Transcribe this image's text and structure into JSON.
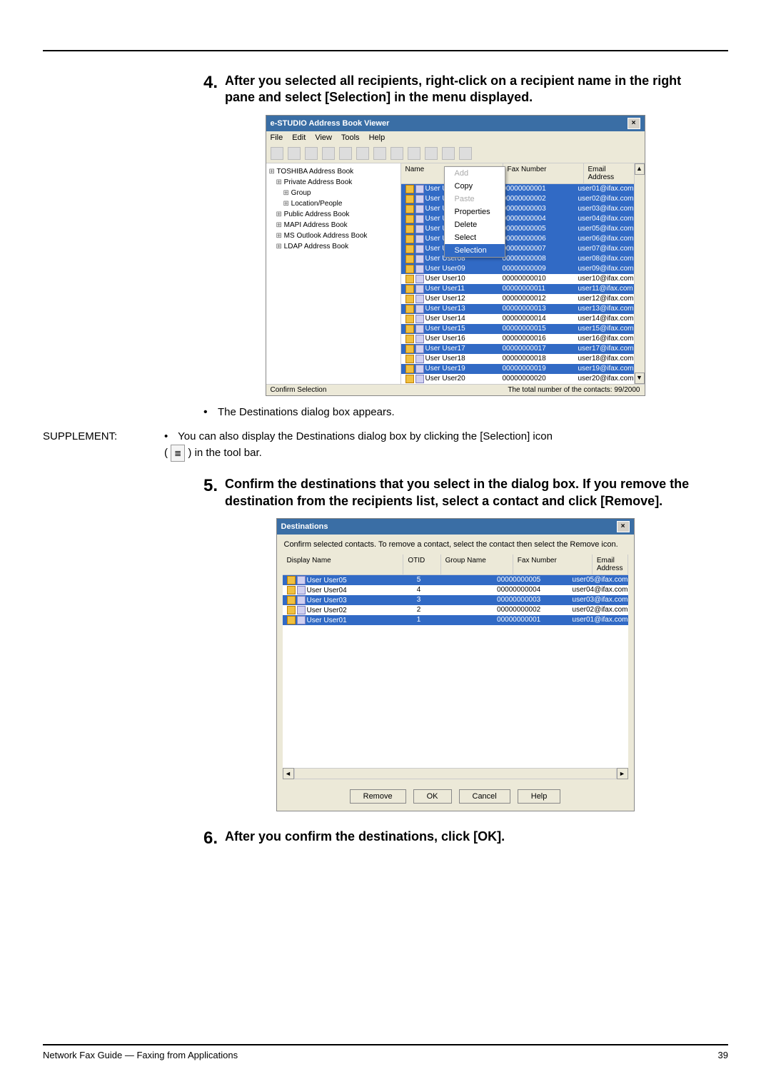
{
  "steps": {
    "s4": {
      "num": "4.",
      "text": "After you selected all recipients,  right-click on a recipient name in the right pane and select [Selection] in the menu displayed."
    },
    "s5": {
      "num": "5.",
      "text": "Confirm the destinations that you select in the dialog box.  If you remove the destination from the recipients list, select a contact and click [Remove]."
    },
    "s6": {
      "num": "6.",
      "text": "After you confirm the destinations, click [OK]."
    }
  },
  "bullet1": "The Destinations dialog box appears.",
  "supplement": {
    "label": "SUPPLEMENT:",
    "text1": "You can also display the Destinations dialog box by clicking the [Selection] icon",
    "text2": ") in the tool bar.",
    "iconglyph": "≣"
  },
  "win1": {
    "title": "e-STUDIO Address Book Viewer",
    "menus": [
      "File",
      "Edit",
      "View",
      "Tools",
      "Help"
    ],
    "tree": [
      "TOSHIBA Address Book",
      "Private Address Book",
      "Group",
      "Location/People",
      "Public Address Book",
      "MAPI Address Book",
      "MS Outlook Address Book",
      "LDAP Address Book"
    ],
    "cols": {
      "name": "Name",
      "fax": "Fax Number",
      "email": "Email Address"
    },
    "ctx": [
      "Add",
      "Copy",
      "Paste",
      "Properties",
      "Delete",
      "Select",
      "Selection"
    ],
    "rows": [
      {
        "n": "User User01",
        "f": "00000000001",
        "e": "user01@ifax.com",
        "sel": true
      },
      {
        "n": "User User02",
        "f": "00000000002",
        "e": "user02@ifax.com",
        "sel": true
      },
      {
        "n": "User User03",
        "f": "00000000003",
        "e": "user03@ifax.com",
        "sel": true
      },
      {
        "n": "User User04",
        "f": "00000000004",
        "e": "user04@ifax.com",
        "sel": true
      },
      {
        "n": "User User05",
        "f": "00000000005",
        "e": "user05@ifax.com",
        "sel": true
      },
      {
        "n": "User User06",
        "f": "00000000006",
        "e": "user06@ifax.com",
        "sel": true
      },
      {
        "n": "User User07",
        "f": "00000000007",
        "e": "user07@ifax.com",
        "sel": true
      },
      {
        "n": "User User08",
        "f": "00000000008",
        "e": "user08@ifax.com",
        "sel": true
      },
      {
        "n": "User User09",
        "f": "00000000009",
        "e": "user09@ifax.com",
        "sel": true
      },
      {
        "n": "User User10",
        "f": "00000000010",
        "e": "user10@ifax.com",
        "sel": false
      },
      {
        "n": "User User11",
        "f": "00000000011",
        "e": "user11@ifax.com",
        "sel": true
      },
      {
        "n": "User User12",
        "f": "00000000012",
        "e": "user12@ifax.com",
        "sel": false
      },
      {
        "n": "User User13",
        "f": "00000000013",
        "e": "user13@ifax.com",
        "sel": true
      },
      {
        "n": "User User14",
        "f": "00000000014",
        "e": "user14@ifax.com",
        "sel": false
      },
      {
        "n": "User User15",
        "f": "00000000015",
        "e": "user15@ifax.com",
        "sel": true
      },
      {
        "n": "User User16",
        "f": "00000000016",
        "e": "user16@ifax.com",
        "sel": false
      },
      {
        "n": "User User17",
        "f": "00000000017",
        "e": "user17@ifax.com",
        "sel": true
      },
      {
        "n": "User User18",
        "f": "00000000018",
        "e": "user18@ifax.com",
        "sel": false
      },
      {
        "n": "User User19",
        "f": "00000000019",
        "e": "user19@ifax.com",
        "sel": true
      },
      {
        "n": "User User20",
        "f": "00000000020",
        "e": "user20@ifax.com",
        "sel": false
      }
    ],
    "status": {
      "left": "Confirm Selection",
      "right": "The total number of the contacts: 99/2000"
    }
  },
  "win2": {
    "title": "Destinations",
    "desc": "Confirm selected contacts. To remove a contact, select the contact then select the Remove icon.",
    "cols": {
      "display": "Display Name",
      "otid": "OTID",
      "group": "Group Name",
      "fax": "Fax Number",
      "email": "Email Address"
    },
    "rows": [
      {
        "d": "User User05",
        "o": "5",
        "f": "00000000005",
        "e": "user05@ifax.com",
        "sel": true
      },
      {
        "d": "User User04",
        "o": "4",
        "f": "00000000004",
        "e": "user04@ifax.com",
        "sel": false
      },
      {
        "d": "User User03",
        "o": "3",
        "f": "00000000003",
        "e": "user03@ifax.com",
        "sel": true
      },
      {
        "d": "User User02",
        "o": "2",
        "f": "00000000002",
        "e": "user02@ifax.com",
        "sel": false
      },
      {
        "d": "User User01",
        "o": "1",
        "f": "00000000001",
        "e": "user01@ifax.com",
        "sel": true
      }
    ],
    "buttons": {
      "remove": "Remove",
      "ok": "OK",
      "cancel": "Cancel",
      "help": "Help"
    }
  },
  "footer": {
    "left": "Network Fax Guide — Faxing from Applications",
    "right": "39"
  }
}
